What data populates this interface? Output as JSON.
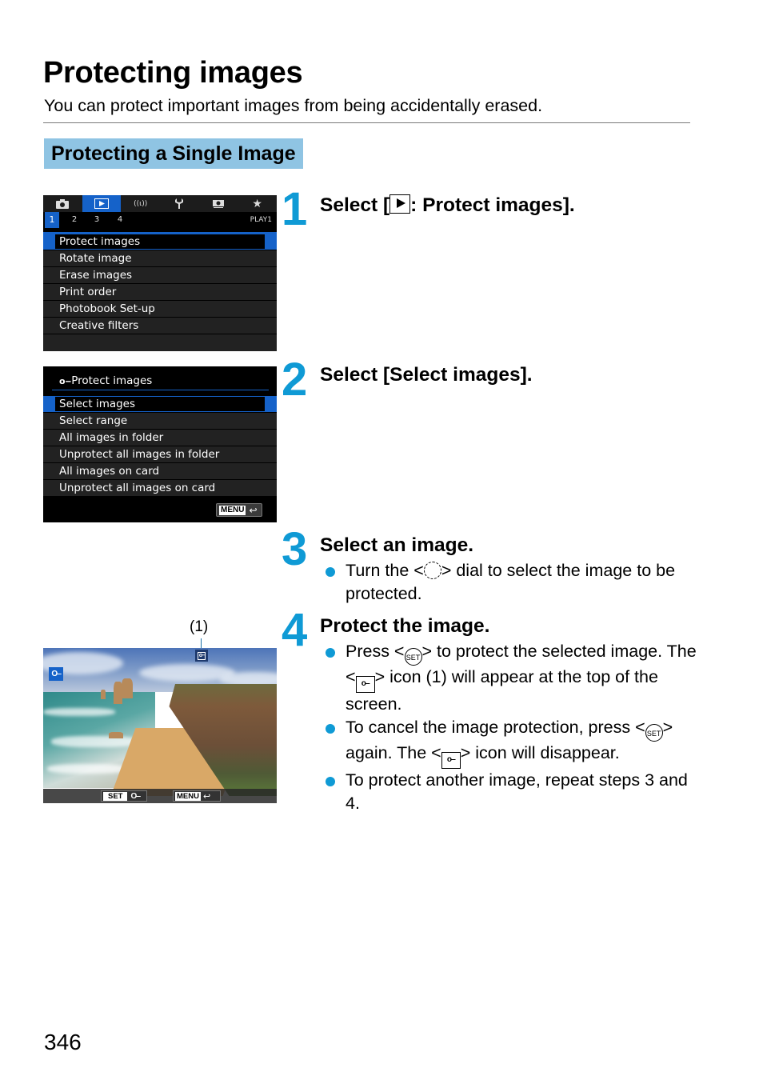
{
  "page": {
    "title": "Protecting images",
    "intro": "You can protect important images from being accidentally erased.",
    "section_heading": "Protecting a Single Image",
    "page_number": "346",
    "accent_color": "#0f9ad5",
    "section_color": "#8fc4e3"
  },
  "screen1": {
    "tabs": [
      {
        "icon": "camera-icon",
        "glyph": "📷"
      },
      {
        "icon": "playback-icon",
        "glyph": "▶",
        "active": true
      },
      {
        "icon": "wireless-icon",
        "glyph": "((ι))"
      },
      {
        "icon": "wrench-icon",
        "glyph": "🔧"
      },
      {
        "icon": "custom-icon",
        "glyph": "⚙"
      },
      {
        "icon": "star-icon",
        "glyph": "★"
      }
    ],
    "subtabs": [
      "1",
      "2",
      "3",
      "4"
    ],
    "active_subtab": "1",
    "page_label": "PLAY1",
    "items": [
      "Protect images",
      "Rotate image",
      "Erase images",
      "Print order",
      "Photobook Set-up",
      "Creative filters"
    ],
    "selected": "Protect images"
  },
  "screen2": {
    "title": "Protect images",
    "key_glyph": "o‒",
    "items": [
      "Select images",
      "Select range",
      "All images in folder",
      "Unprotect all images in folder",
      "All images on card",
      "Unprotect all images on card"
    ],
    "selected": "Select images",
    "menu_button": "MENU",
    "return_glyph": "↩"
  },
  "screen3": {
    "callout": "(1)",
    "set_button": "SET",
    "menu_button": "MENU",
    "key_glyph": "O‒",
    "return_glyph": "↩"
  },
  "steps": [
    {
      "number": "1",
      "title_pre": "Select [",
      "title_post": ": Protect images]."
    },
    {
      "number": "2",
      "title": "Select [Select images]."
    },
    {
      "number": "3",
      "title": "Select an image.",
      "bullets": [
        {
          "a": "Turn the <",
          "b": "> dial to select the image to be protected."
        }
      ]
    },
    {
      "number": "4",
      "title": "Protect the image.",
      "bullets": [
        {
          "a": "Press <",
          "b": "> to protect the selected image. The <",
          "c": "> icon (1) will appear at the top of the screen."
        },
        {
          "a": "To cancel the image protection, press <",
          "b": "> again. The <",
          "c": "> icon will disappear."
        },
        {
          "a": "To protect another image, repeat steps 3 and 4."
        }
      ]
    }
  ],
  "icons": {
    "set": "SET",
    "key": "o‒"
  }
}
